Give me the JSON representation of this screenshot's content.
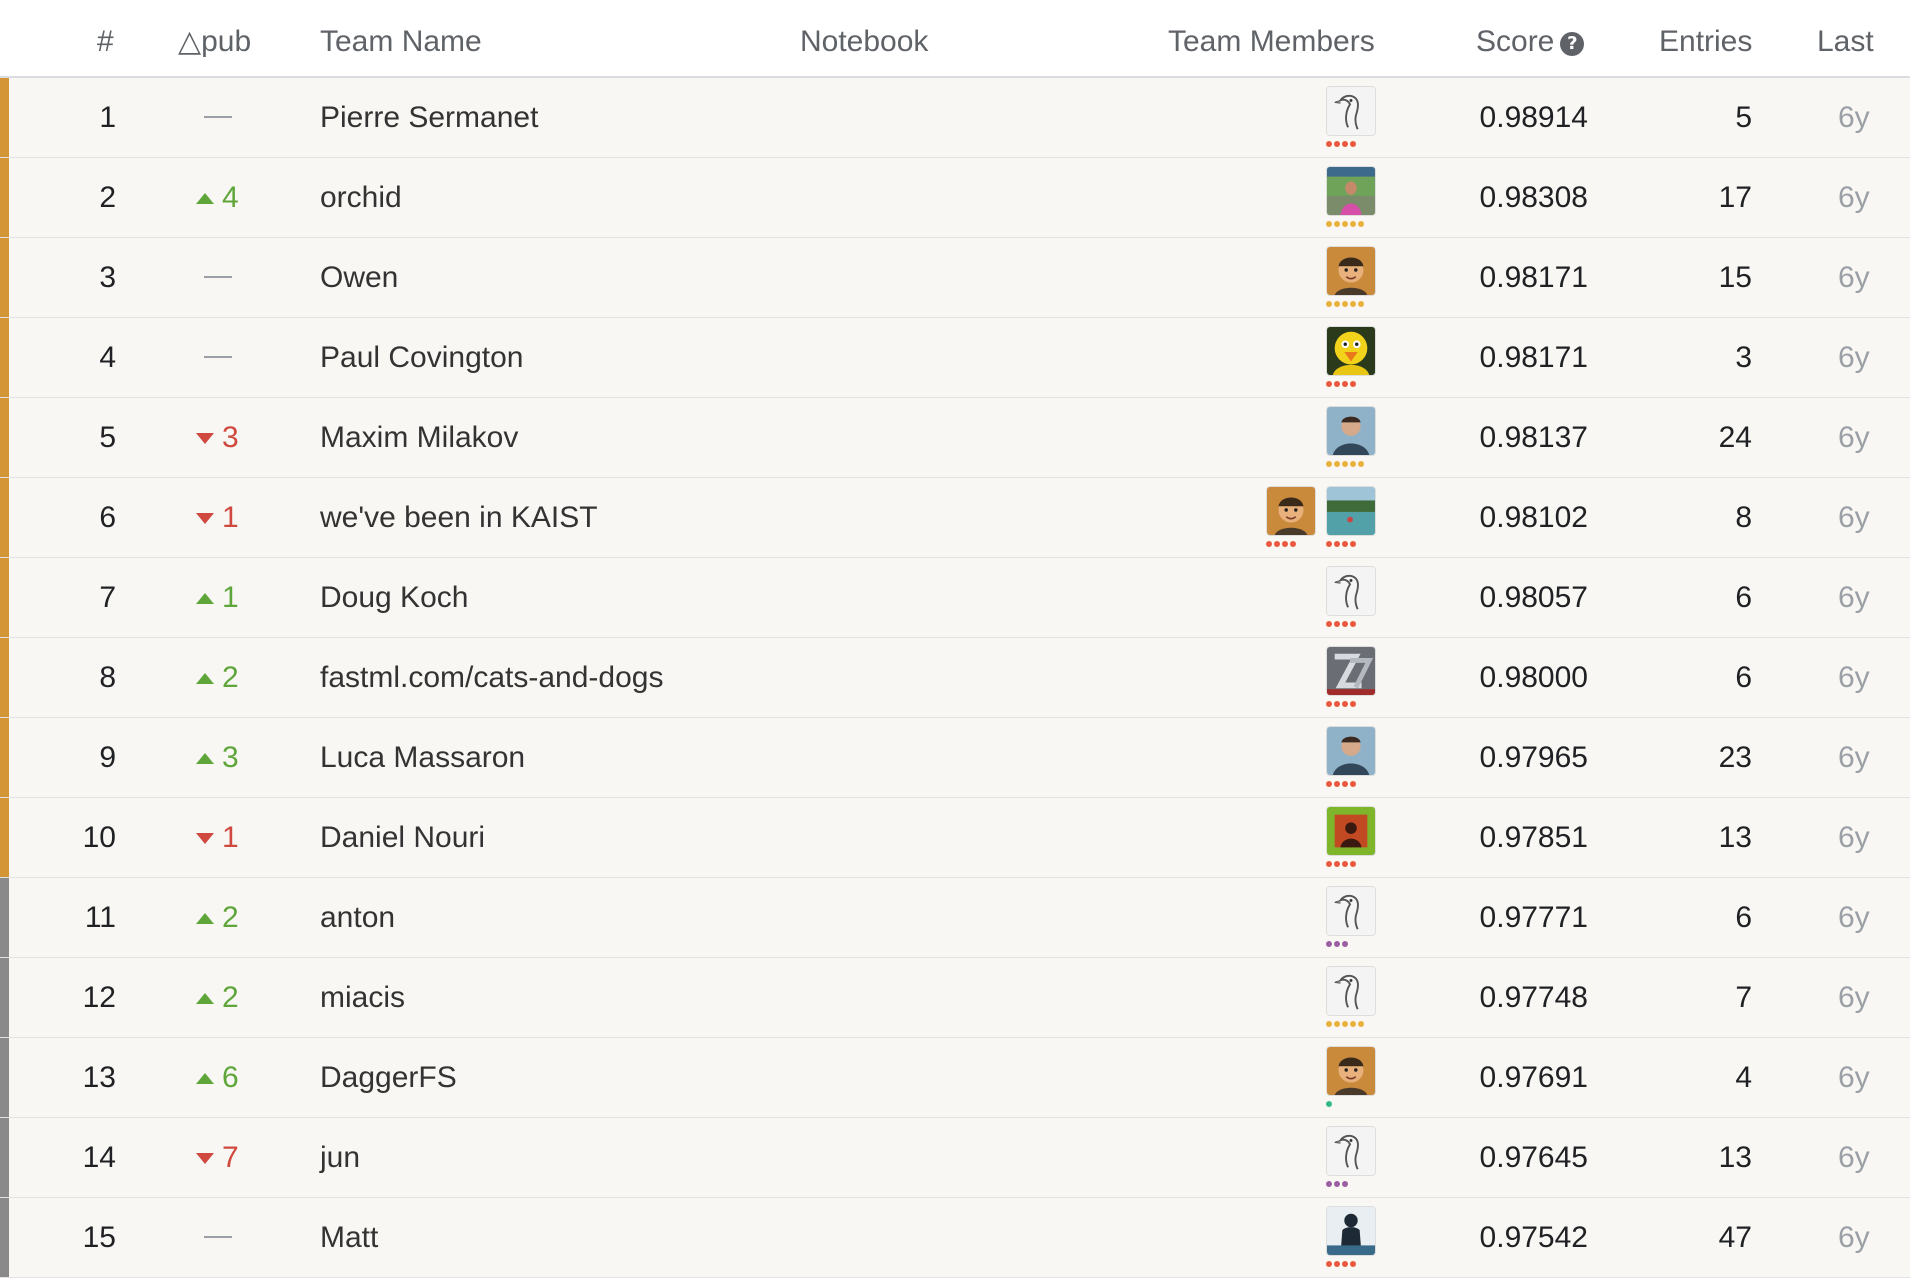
{
  "header": {
    "rank": "#",
    "delta": "△pub",
    "team_name": "Team Name",
    "notebook": "Notebook",
    "team_members": "Team Members",
    "score": "Score",
    "entries": "Entries",
    "last": "Last"
  },
  "colors": {
    "gold_stripe": "#d39536",
    "silver_stripe": "#8a8a8a",
    "up": "#5fa63a",
    "down": "#d0493e",
    "tier_red": "#e95a3c",
    "tier_gold": "#e8b13c",
    "tier_purple": "#9b5ea0",
    "tier_green": "#35b885"
  },
  "rows": [
    {
      "rank": "1",
      "delta": "",
      "dir": "flat",
      "team": "Pierre Sermanet",
      "score": "0.98914",
      "entries": "5",
      "last": "6y",
      "medal": "gold",
      "avatars": [
        {
          "icon": "goose-icon",
          "tier": "red",
          "dots": 4
        }
      ]
    },
    {
      "rank": "2",
      "delta": "4",
      "dir": "up",
      "team": "orchid",
      "score": "0.98308",
      "entries": "17",
      "last": "6y",
      "medal": "gold",
      "avatars": [
        {
          "icon": "photo-person-icon",
          "tier": "gold",
          "dots": 5
        }
      ]
    },
    {
      "rank": "3",
      "delta": "",
      "dir": "flat",
      "team": "Owen",
      "score": "0.98171",
      "entries": "15",
      "last": "6y",
      "medal": "gold",
      "avatars": [
        {
          "icon": "photo-face-icon",
          "tier": "gold",
          "dots": 5
        }
      ]
    },
    {
      "rank": "4",
      "delta": "",
      "dir": "flat",
      "team": "Paul Covington",
      "score": "0.98171",
      "entries": "3",
      "last": "6y",
      "medal": "gold",
      "avatars": [
        {
          "icon": "big-bird-icon",
          "tier": "red",
          "dots": 4
        }
      ]
    },
    {
      "rank": "5",
      "delta": "3",
      "dir": "down",
      "team": "Maxim Milakov",
      "score": "0.98137",
      "entries": "24",
      "last": "6y",
      "medal": "gold",
      "avatars": [
        {
          "icon": "photo-portrait-icon",
          "tier": "gold",
          "dots": 5
        }
      ]
    },
    {
      "rank": "6",
      "delta": "1",
      "dir": "down",
      "team": "we've been in KAIST",
      "score": "0.98102",
      "entries": "8",
      "last": "6y",
      "medal": "gold",
      "avatars": [
        {
          "icon": "photo-face-icon",
          "tier": "red",
          "dots": 4
        },
        {
          "icon": "photo-landscape-icon",
          "tier": "red",
          "dots": 4
        }
      ]
    },
    {
      "rank": "7",
      "delta": "1",
      "dir": "up",
      "team": "Doug Koch",
      "score": "0.98057",
      "entries": "6",
      "last": "6y",
      "medal": "gold",
      "avatars": [
        {
          "icon": "goose-icon",
          "tier": "red",
          "dots": 4
        }
      ]
    },
    {
      "rank": "8",
      "delta": "2",
      "dir": "up",
      "team": "fastml.com/cats-and-dogs",
      "score": "0.98000",
      "entries": "6",
      "last": "6y",
      "medal": "gold",
      "avatars": [
        {
          "icon": "logo-z-icon",
          "tier": "red",
          "dots": 4
        }
      ]
    },
    {
      "rank": "9",
      "delta": "3",
      "dir": "up",
      "team": "Luca Massaron",
      "score": "0.97965",
      "entries": "23",
      "last": "6y",
      "medal": "gold",
      "avatars": [
        {
          "icon": "photo-portrait-icon",
          "tier": "red",
          "dots": 4
        }
      ]
    },
    {
      "rank": "10",
      "delta": "1",
      "dir": "down",
      "team": "Daniel Nouri",
      "score": "0.97851",
      "entries": "13",
      "last": "6y",
      "medal": "gold",
      "avatars": [
        {
          "icon": "silhouette-icon",
          "tier": "red",
          "dots": 4
        }
      ]
    },
    {
      "rank": "11",
      "delta": "2",
      "dir": "up",
      "team": "anton",
      "score": "0.97771",
      "entries": "6",
      "last": "6y",
      "medal": "silver",
      "avatars": [
        {
          "icon": "goose-icon",
          "tier": "purple",
          "dots": 3
        }
      ]
    },
    {
      "rank": "12",
      "delta": "2",
      "dir": "up",
      "team": "miacis",
      "score": "0.97748",
      "entries": "7",
      "last": "6y",
      "medal": "silver",
      "avatars": [
        {
          "icon": "goose-icon",
          "tier": "gold",
          "dots": 5
        }
      ]
    },
    {
      "rank": "13",
      "delta": "6",
      "dir": "up",
      "team": "DaggerFS",
      "score": "0.97691",
      "entries": "4",
      "last": "6y",
      "medal": "silver",
      "avatars": [
        {
          "icon": "photo-face-icon",
          "tier": "green",
          "dots": 1
        }
      ]
    },
    {
      "rank": "14",
      "delta": "7",
      "dir": "down",
      "team": "jun",
      "score": "0.97645",
      "entries": "13",
      "last": "6y",
      "medal": "silver",
      "avatars": [
        {
          "icon": "goose-icon",
          "tier": "purple",
          "dots": 3
        }
      ]
    },
    {
      "rank": "15",
      "delta": "",
      "dir": "flat",
      "team": "Matt",
      "score": "0.97542",
      "entries": "47",
      "last": "6y",
      "medal": "silver",
      "avatars": [
        {
          "icon": "photo-statue-icon",
          "tier": "red",
          "dots": 4
        }
      ]
    }
  ]
}
